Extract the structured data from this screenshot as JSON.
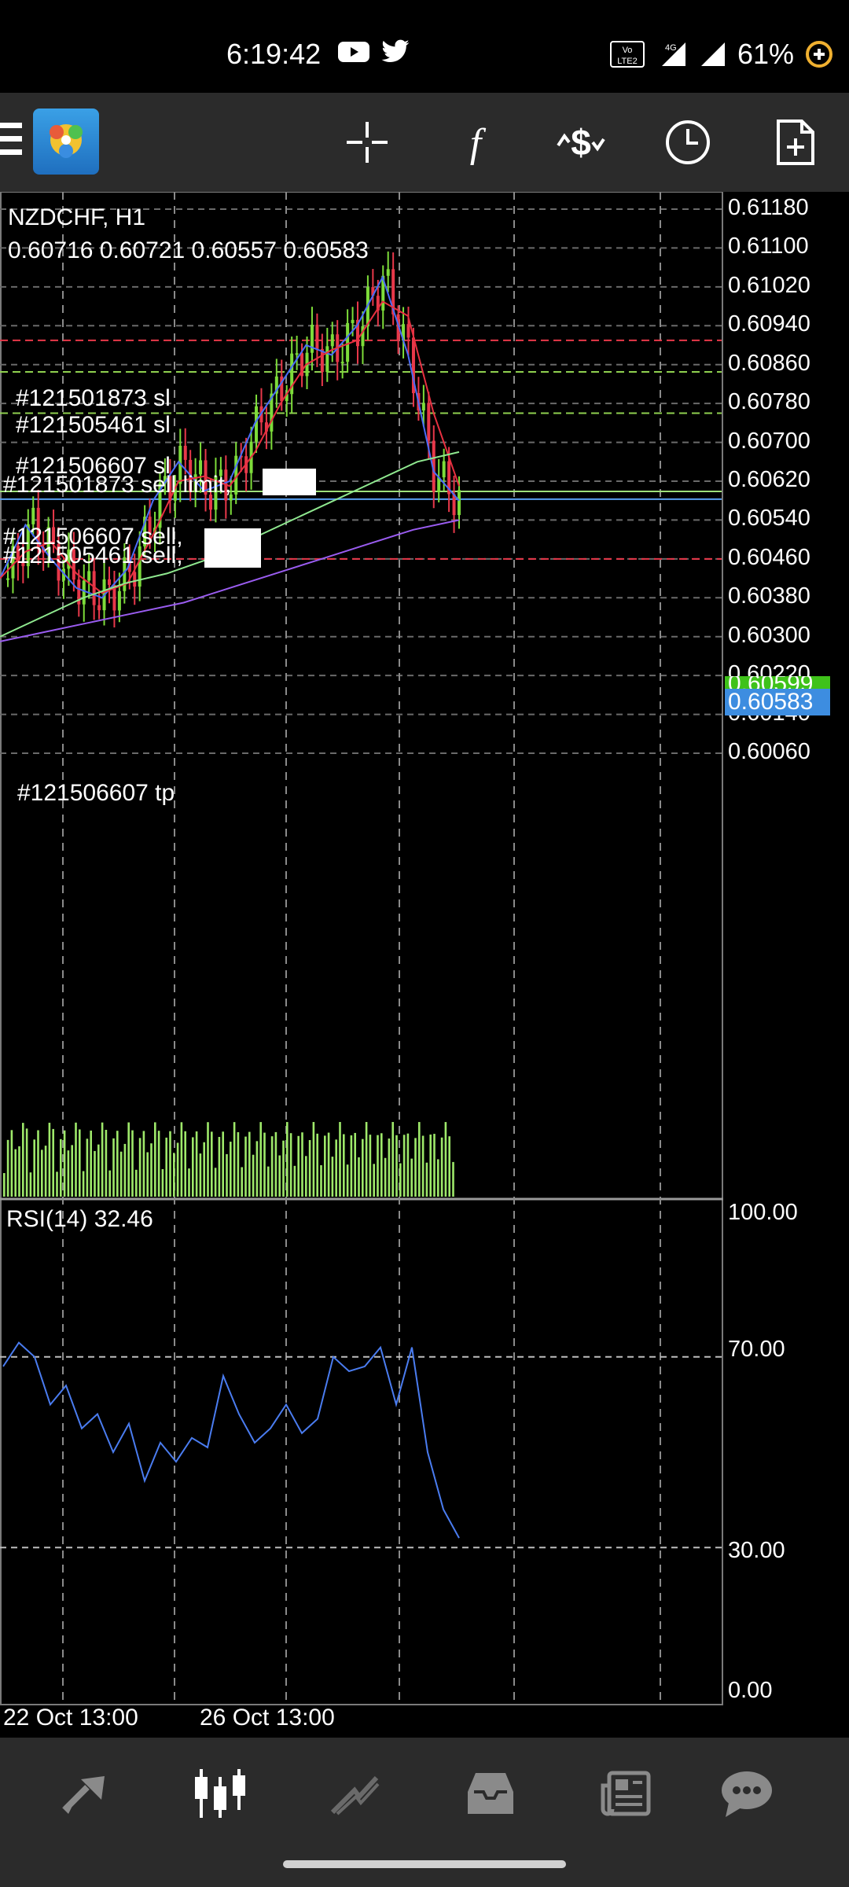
{
  "status_bar": {
    "time": "6:19:42",
    "battery": "61%",
    "network": "4G",
    "volte": "LTE2"
  },
  "toolbar": {
    "menu_icon": "hamburger-menu-icon",
    "app_icon": "metatrader-logo",
    "buttons": [
      "crosshair-icon",
      "indicator-function-icon",
      "symbols-icon",
      "timeframe-clock-icon",
      "new-order-icon"
    ]
  },
  "chart": {
    "symbol_line": "NZDCHF, H1",
    "ohlc_line": "0.60716 0.60721 0.60557 0.60583",
    "price_axis": [
      "0.61180",
      "0.61100",
      "0.61020",
      "0.60940",
      "0.60860",
      "0.60780",
      "0.60700",
      "0.60620",
      "0.60540",
      "0.60460",
      "0.60380",
      "0.60300",
      "0.60220",
      "0.60140",
      "0.60060"
    ],
    "current_price_tag": "0.60583",
    "green_price_tag": "0.60599",
    "order_labels": [
      "#121501873 sl",
      "#121505461 sl",
      "#121506607 sl",
      "#121501873 sell limit,",
      "#121506607 sell,",
      "#121505461 sell,",
      "#121506607 tp"
    ],
    "date_labels": [
      "22 Oct 13:00",
      "26 Oct 13:00"
    ],
    "colors": {
      "candle_up": "#7ddc3a",
      "candle_down": "#e8384a",
      "ma_fast": "#4a6cf7",
      "ma_mid": "#e83040",
      "ma_slow_green": "#8fe88f",
      "ma_slow_violet": "#9a5cf0",
      "current_price_tag_bg": "#3d8de0",
      "green_tag_bg": "#3fc21a",
      "sl_line": "#e8384a",
      "sell_line": "#8fd14f"
    }
  },
  "chart_data": {
    "type": "line",
    "title": "NZDCHF, H1",
    "ylim": [
      0.6002,
      0.612
    ],
    "y_ticks": [
      0.6118,
      0.611,
      0.6102,
      0.6094,
      0.6086,
      0.6078,
      0.607,
      0.6062,
      0.6054,
      0.6046,
      0.6038,
      0.603,
      0.6022,
      0.6014,
      0.6006
    ],
    "current_price": 0.60583,
    "ohlc": {
      "open": 0.60716,
      "high": 0.60721,
      "low": 0.60557,
      "close": 0.60583
    },
    "series": [
      {
        "values": [
          0.6042,
          0.6053,
          0.6046,
          0.604,
          0.6038,
          0.6044,
          0.6058,
          0.6066,
          0.606,
          0.6062,
          0.6074,
          0.6082,
          0.609,
          0.6088,
          0.6094,
          0.6104,
          0.6088,
          0.6064,
          0.6058
        ]
      },
      {
        "values": [
          0.603,
          0.6034,
          0.6038,
          0.6041,
          0.6043,
          0.6046,
          0.605,
          0.6054,
          0.6058,
          0.6062,
          0.6066,
          0.6068
        ]
      },
      {
        "values": [
          0.6029,
          0.6031,
          0.6033,
          0.6035,
          0.6037,
          0.604,
          0.6043,
          0.6046,
          0.6049,
          0.6052,
          0.6054
        ]
      }
    ],
    "rsi": {
      "label": "RSI(14) 32.46",
      "value": 32.46,
      "levels": [
        "100.00",
        "70.00",
        "30.00",
        "0.00"
      ],
      "values": [
        68,
        73,
        70,
        60,
        64,
        55,
        58,
        50,
        56,
        44,
        52,
        48,
        53,
        51,
        66,
        58,
        52,
        55,
        60,
        54,
        57,
        70,
        67,
        68,
        72,
        60,
        72,
        50,
        38,
        32
      ]
    }
  },
  "bottom_nav": {
    "items": [
      "quotes-icon",
      "chart-icon",
      "trade-icon",
      "history-icon",
      "news-icon",
      "chat-icon"
    ]
  }
}
